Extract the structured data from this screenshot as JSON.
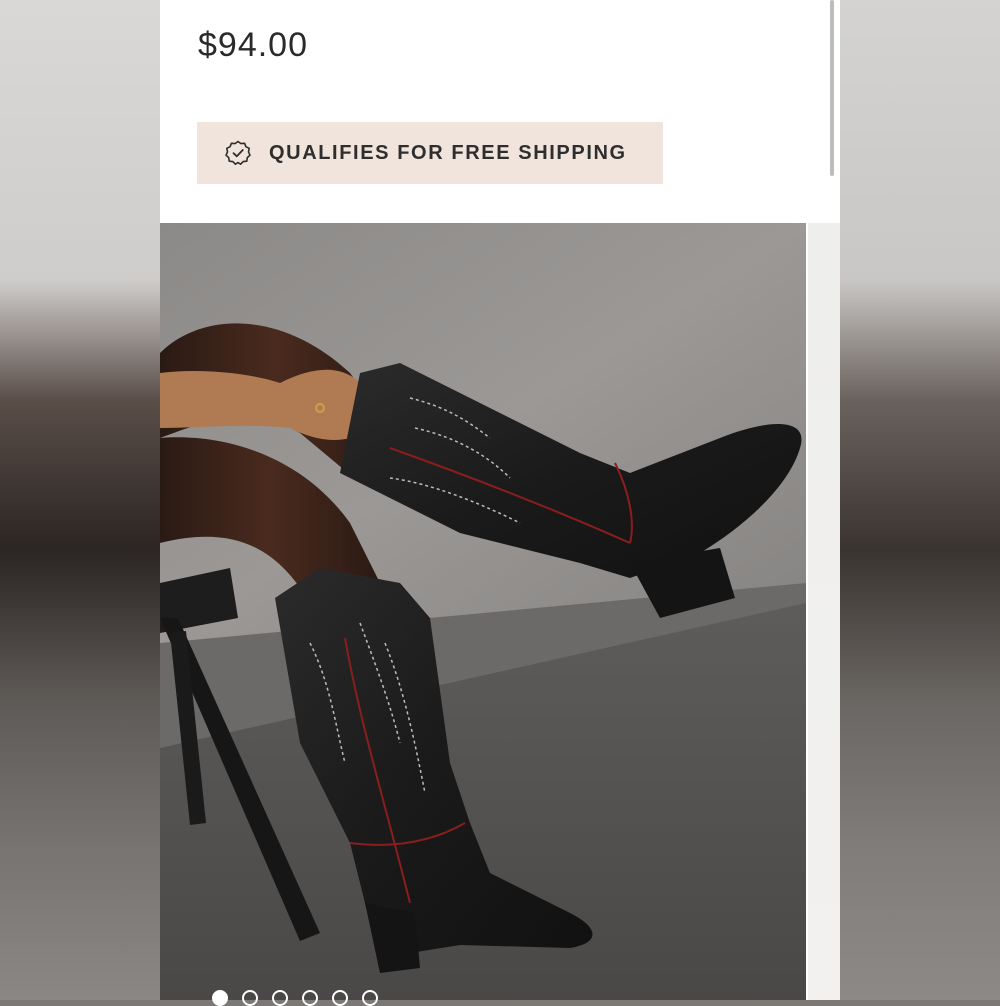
{
  "product": {
    "price": "$94.00"
  },
  "shipping": {
    "label": "QUALIFIES FOR FREE SHIPPING",
    "icon": "badge-check-icon"
  },
  "gallery": {
    "image_count": 6,
    "active_index": 0
  },
  "colors": {
    "shipping_bg": "#f0e4dc",
    "text": "#2a2a2a"
  }
}
